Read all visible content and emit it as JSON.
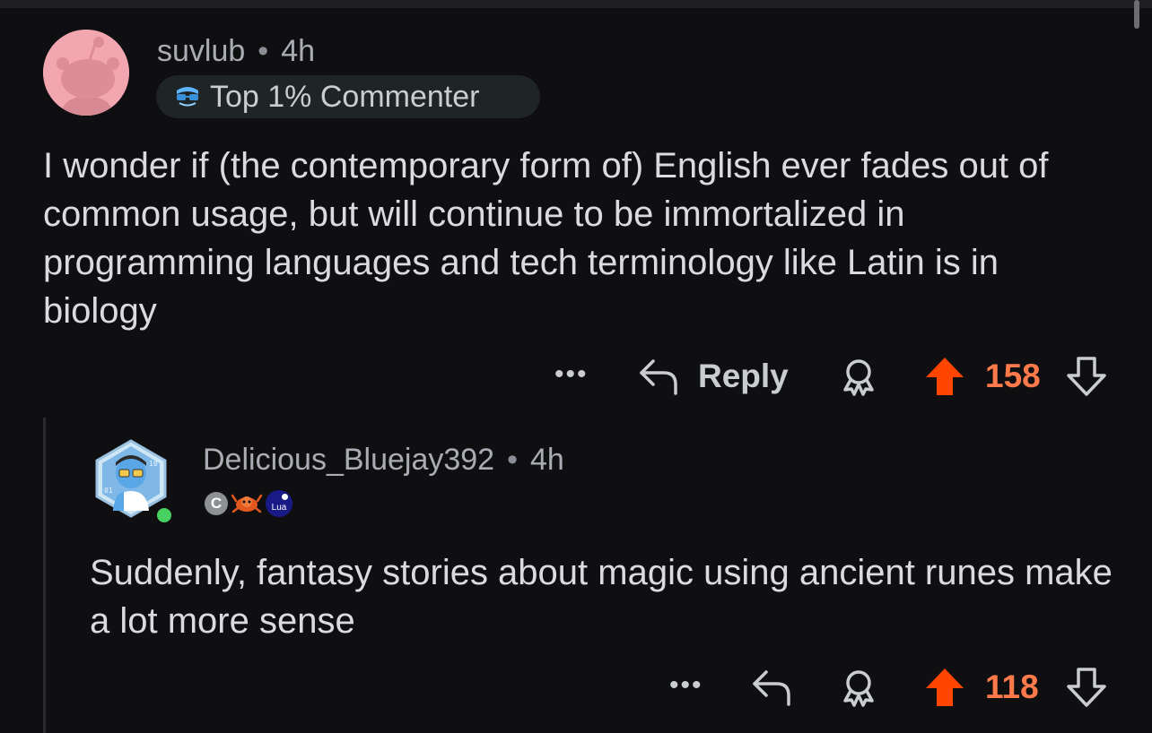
{
  "comments": [
    {
      "author": "suvlub",
      "separator": "•",
      "age": "4h",
      "flair": "Top 1% Commenter",
      "body": "I wonder if (the contemporary form of) English ever fades out of common usage, but will continue to be immortalized in programming languages and tech terminology like Latin is in biology",
      "actions": {
        "more_label": "•••",
        "reply_label": "Reply",
        "score": "158"
      }
    },
    {
      "author": "Delicious_Bluejay392",
      "separator": "•",
      "age": "4h",
      "badges": {
        "c_label": "C",
        "lua_label": "Lua"
      },
      "body": "Suddenly, fantasy stories about magic using ancient runes make a lot more sense",
      "actions": {
        "more_label": "•••",
        "score": "118"
      }
    }
  ],
  "colors": {
    "background": "#0f0f11",
    "upvote_active": "#ff4500",
    "score_active": "#ff7a4a",
    "text_primary": "#d9dbde",
    "text_muted": "#a9adb3",
    "online": "#46d160"
  },
  "icons": [
    "snoo-avatar",
    "top-commenter-icon",
    "reply-icon",
    "award-icon",
    "upvote-icon",
    "downvote-icon",
    "user-avatar",
    "c-language-badge",
    "rust-crab-badge",
    "lua-badge"
  ]
}
